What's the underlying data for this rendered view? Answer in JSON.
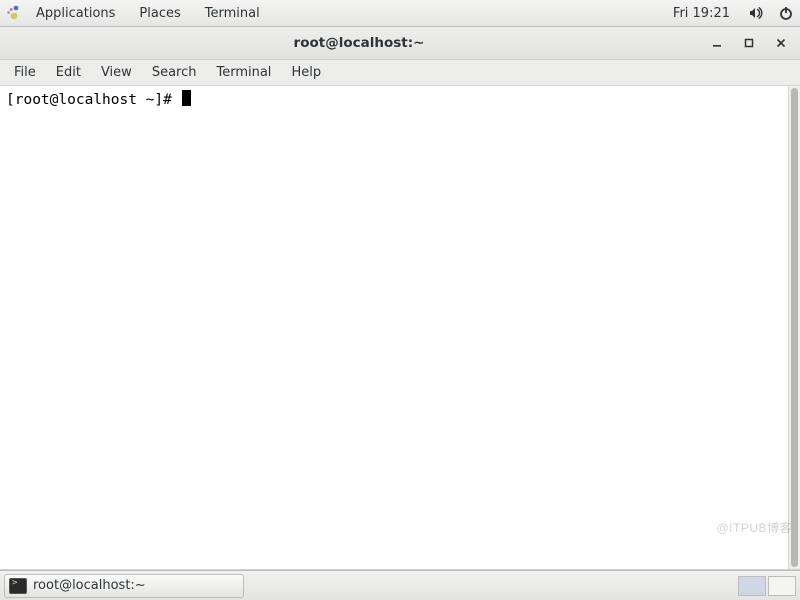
{
  "top_panel": {
    "applications": "Applications",
    "places": "Places",
    "terminal": "Terminal",
    "clock": "Fri 19:21"
  },
  "window": {
    "title": "root@localhost:~"
  },
  "menubar": {
    "file": "File",
    "edit": "Edit",
    "view": "View",
    "search": "Search",
    "terminal": "Terminal",
    "help": "Help"
  },
  "terminal": {
    "prompt": "[root@localhost ~]# "
  },
  "taskbar": {
    "task1_label": "root@localhost:~"
  },
  "watermark": "@ITPUB博客"
}
